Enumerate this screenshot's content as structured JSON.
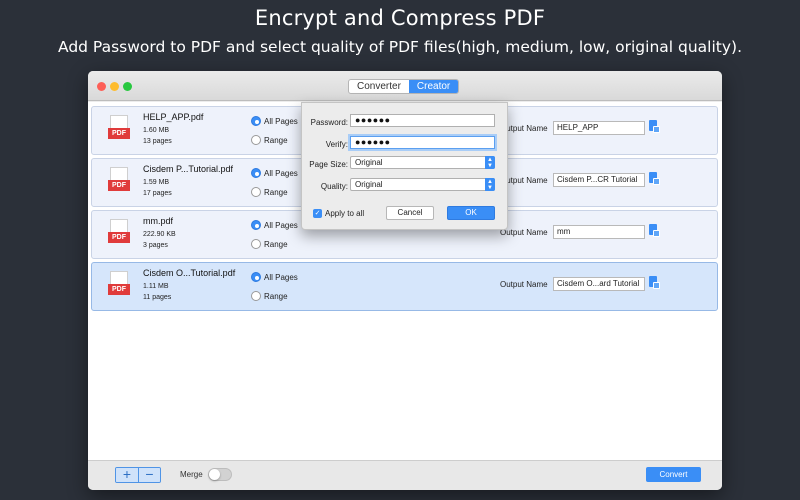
{
  "headline": "Encrypt and Compress PDF",
  "subheadline": "Add Password to PDF and select quality of PDF files(high, medium, low, original quality).",
  "colors": {
    "accent": "#3a8ef6",
    "pdf_red": "#e03b3b",
    "close": "#fd5f57",
    "minimize": "#febc2e",
    "zoom": "#28c840"
  },
  "window": {
    "tabs": [
      {
        "label": "Converter"
      },
      {
        "label": "Creator",
        "active": true
      }
    ]
  },
  "file_icon": {
    "label": "PDF",
    "icon": "pdf-file-icon"
  },
  "files": [
    {
      "name": "HELP_APP.pdf",
      "size": "1.60 MB",
      "pages": "13 pages",
      "all_pages": "All Pages",
      "range": "Range",
      "output_label": "Output Name",
      "output_name": "HELP_APP",
      "selected": false
    },
    {
      "name": "Cisdem P...Tutorial.pdf",
      "size": "1.59 MB",
      "pages": "17 pages",
      "all_pages": "All Pages",
      "range": "Range",
      "output_label": "Output Name",
      "output_name": "Cisdem P...CR Tutorial",
      "selected": false
    },
    {
      "name": "mm.pdf",
      "size": "222.90 KB",
      "pages": "3 pages",
      "all_pages": "All Pages",
      "range": "Range",
      "output_label": "Output Name",
      "output_name": "mm",
      "selected": false
    },
    {
      "name": "Cisdem O...Tutorial.pdf",
      "size": "1.11 MB",
      "pages": "11 pages",
      "all_pages": "All Pages",
      "range": "Range",
      "output_label": "Output Name",
      "output_name": "Cisdem O...ard Tutorial",
      "selected": true
    }
  ],
  "popup": {
    "password_label": "Password:",
    "password_value": "●●●●●●",
    "verify_label": "Verify:",
    "verify_value": "●●●●●●",
    "page_size_label": "Page Size:",
    "page_size_value": "Original",
    "quality_label": "Quality:",
    "quality_value": "Original",
    "apply_all_label": "Apply to all",
    "cancel_label": "Cancel",
    "ok_label": "OK"
  },
  "bottom": {
    "add_label": "+",
    "remove_label": "−",
    "merge_label": "Merge",
    "merge_on": false,
    "convert_label": "Convert"
  }
}
